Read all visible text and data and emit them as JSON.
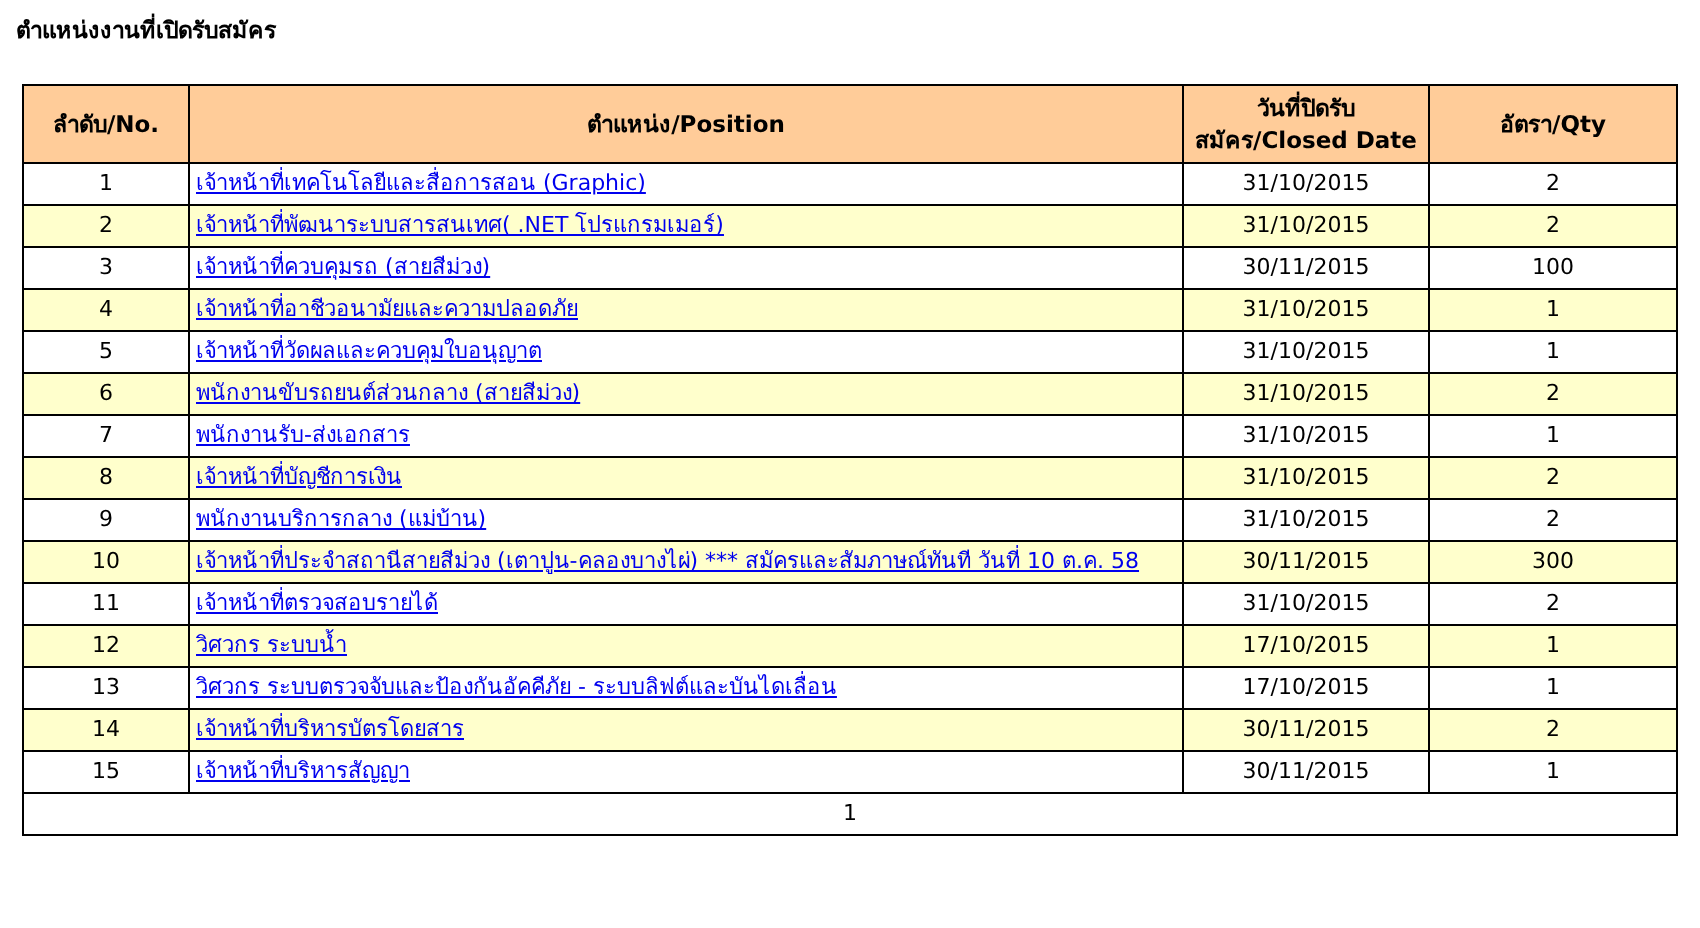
{
  "title": "ตำแหน่งงานที่เปิดรับสมัคร",
  "table": {
    "columns": [
      "ลำดับ/No.",
      "ตำแหน่ง/Position",
      "วันที่ปิดรับสมัคร/Closed Date",
      "อัตรา/Qty"
    ],
    "rows": [
      {
        "no": "1",
        "position": "เจ้าหน้าที่เทคโนโลยีและสื่อการสอน (Graphic)",
        "closed_date": "31/10/2015",
        "qty": "2"
      },
      {
        "no": "2",
        "position": "เจ้าหน้าที่พัฒนาระบบสารสนเทศ( .NET โปรแกรมเมอร์)",
        "closed_date": "31/10/2015",
        "qty": "2"
      },
      {
        "no": "3",
        "position": "เจ้าหน้าที่ควบคุมรถ (สายสีม่วง)",
        "closed_date": "30/11/2015",
        "qty": "100"
      },
      {
        "no": "4",
        "position": "เจ้าหน้าที่อาชีวอนามัยและความปลอดภัย",
        "closed_date": "31/10/2015",
        "qty": "1"
      },
      {
        "no": "5",
        "position": "เจ้าหน้าที่วัดผลและควบคุมใบอนุญาต",
        "closed_date": "31/10/2015",
        "qty": "1"
      },
      {
        "no": "6",
        "position": "พนักงานขับรถยนต์ส่วนกลาง (สายสีม่วง)",
        "closed_date": "31/10/2015",
        "qty": "2"
      },
      {
        "no": "7",
        "position": "พนักงานรับ-ส่งเอกสาร",
        "closed_date": "31/10/2015",
        "qty": "1"
      },
      {
        "no": "8",
        "position": "เจ้าหน้าที่บัญชีการเงิน",
        "closed_date": "31/10/2015",
        "qty": "2"
      },
      {
        "no": "9",
        "position": "พนักงานบริการกลาง (แม่บ้าน)",
        "closed_date": "31/10/2015",
        "qty": "2"
      },
      {
        "no": "10",
        "position": "เจ้าหน้าที่ประจำสถานีสายสีม่วง (เตาปูน-คลองบางไผ่) *** สมัครและสัมภาษณ์ทันที วันที่ 10 ต.ค. 58",
        "closed_date": "30/11/2015",
        "qty": "300"
      },
      {
        "no": "11",
        "position": "เจ้าหน้าที่ตรวจสอบรายได้",
        "closed_date": "31/10/2015",
        "qty": "2"
      },
      {
        "no": "12",
        "position": "วิศวกร ระบบน้ำ",
        "closed_date": "17/10/2015",
        "qty": "1"
      },
      {
        "no": "13",
        "position": "วิศวกร ระบบตรวจจับและป้องกันอัคคีภัย - ระบบลิฟต์และบันไดเลื่อน",
        "closed_date": "17/10/2015",
        "qty": "1"
      },
      {
        "no": "14",
        "position": "เจ้าหน้าที่บริหารบัตรโดยสาร",
        "closed_date": "30/11/2015",
        "qty": "2"
      },
      {
        "no": "15",
        "position": "เจ้าหน้าที่บริหารสัญญา",
        "closed_date": "30/11/2015",
        "qty": "1"
      }
    ],
    "pagination": "1"
  }
}
